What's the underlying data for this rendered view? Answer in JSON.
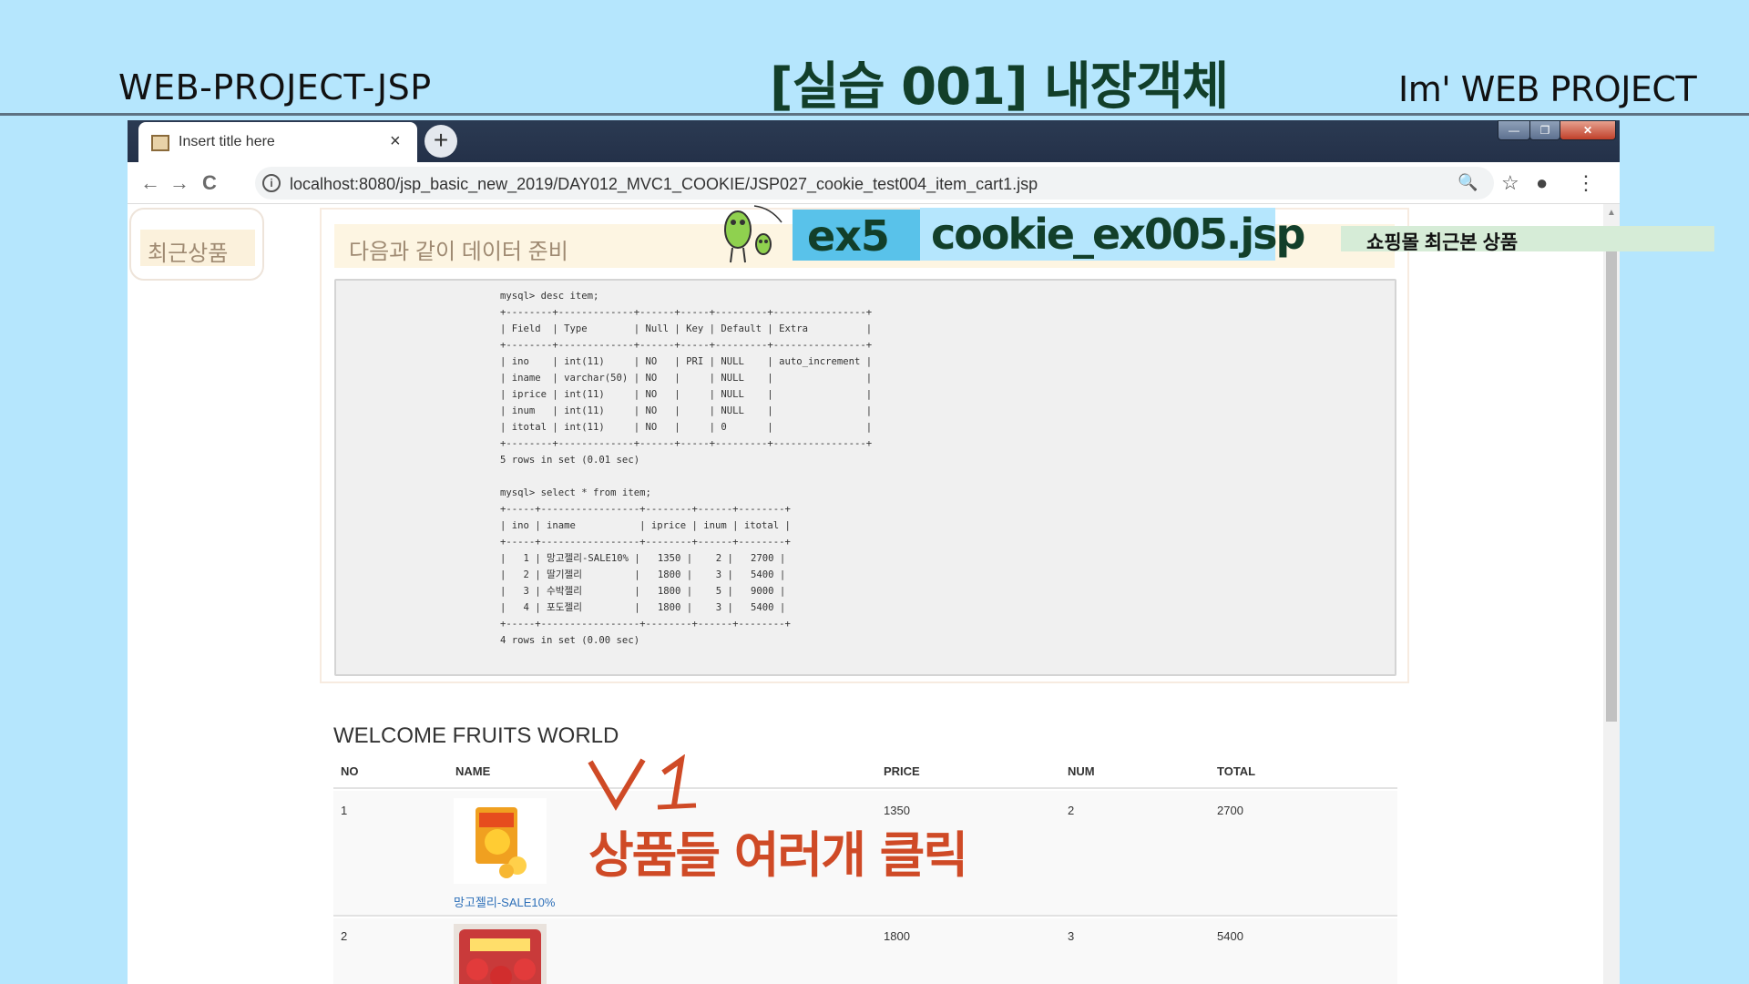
{
  "slide": {
    "left_title": "WEB-PROJECT-JSP",
    "center_title": "[실습 001]  내장객체",
    "right_title": "Im'  WEB PROJECT"
  },
  "browser": {
    "tab_title": "Insert title here",
    "tab_close": "×",
    "new_tab": "+",
    "url": "localhost:8080/jsp_basic_new_2019/DAY012_MVC1_COOKIE/JSP027_cookie_test004_item_cart1.jsp",
    "win_min": "—",
    "win_max": "❐",
    "win_close": "✕",
    "icons": {
      "back": "←",
      "forward": "→",
      "reload": "C",
      "info": "i",
      "zoom": "🔍",
      "star": "☆",
      "account": "●",
      "menu": "⋮"
    }
  },
  "page": {
    "recent_label": "최근상품",
    "prep_heading": "다음과 같이 데이터 준비",
    "sql_output": "mysql> desc item;\n+--------+-------------+------+-----+---------+----------------+\n| Field  | Type        | Null | Key | Default | Extra          |\n+--------+-------------+------+-----+---------+----------------+\n| ino    | int(11)     | NO   | PRI | NULL    | auto_increment |\n| iname  | varchar(50) | NO   |     | NULL    |                |\n| iprice | int(11)     | NO   |     | NULL    |                |\n| inum   | int(11)     | NO   |     | NULL    |                |\n| itotal | int(11)     | NO   |     | 0       |                |\n+--------+-------------+------+-----+---------+----------------+\n5 rows in set (0.01 sec)\n\nmysql> select * from item;\n+-----+-----------------+--------+------+--------+\n| ino | iname           | iprice | inum | itotal |\n+-----+-----------------+--------+------+--------+\n|   1 | 망고젤리-SALE10% |   1350 |    2 |   2700 |\n|   2 | 딸기젤리         |   1800 |    3 |   5400 |\n|   3 | 수박젤리         |   1800 |    5 |   9000 |\n|   4 | 포도젤리         |   1800 |    3 |   5400 |\n+-----+-----------------+--------+------+--------+\n4 rows in set (0.00 sec)",
    "welcome": "WELCOME FRUITS WORLD",
    "table": {
      "headers": [
        "NO",
        "NAME",
        "PRICE",
        "NUM",
        "TOTAL"
      ],
      "rows": [
        {
          "no": "1",
          "name": "망고젤리-SALE10%",
          "price": "1350",
          "num": "2",
          "total": "2700"
        },
        {
          "no": "2",
          "name": "",
          "price": "1800",
          "num": "3",
          "total": "5400"
        }
      ]
    }
  },
  "overlays": {
    "ex_label": "ex5",
    "file_label": "cookie_ex005.jsp",
    "shop_label": "쇼핑몰 최근본 상품",
    "annotation_v1": "V 1",
    "annotation_text": "상품들 여러개 클릭"
  },
  "colors": {
    "slide_bg": "#b5e6fd",
    "title_green": "#123f2a",
    "annotation_red": "#cf4a26",
    "link_blue": "#2d6fb8"
  }
}
